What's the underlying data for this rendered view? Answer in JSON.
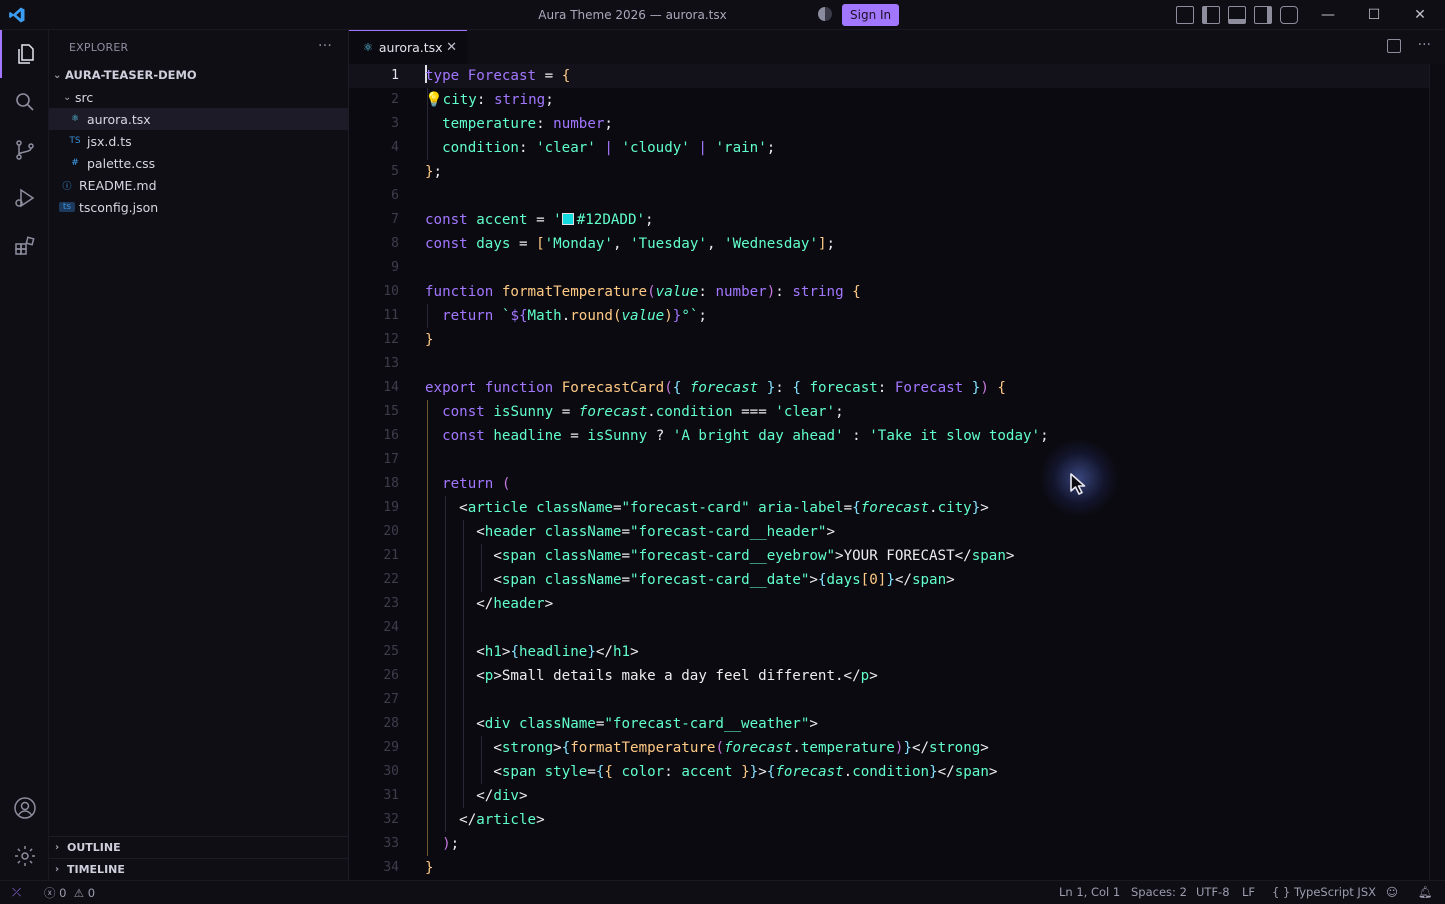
{
  "titlebar": {
    "title": "Aura Theme 2026 — aurora.tsx",
    "sign_in": "Sign In"
  },
  "sidebar": {
    "header": "EXPLORER",
    "more": "···",
    "root": "AURA-TEASER-DEMO",
    "folder": "src",
    "files": [
      {
        "name": "aurora.tsx",
        "icon": "⚛",
        "color": "#61dafb"
      },
      {
        "name": "jsx.d.ts",
        "icon": "TS",
        "color": "#3b8fd6"
      },
      {
        "name": "palette.css",
        "icon": "#",
        "color": "#42a5f5"
      }
    ],
    "root_files": [
      {
        "name": "README.md",
        "icon": "ⓘ",
        "color": "#42a5f5"
      },
      {
        "name": "tsconfig.json",
        "icon": "ts",
        "color": "#3b8fd6"
      }
    ],
    "panels": [
      "OUTLINE",
      "TIMELINE"
    ]
  },
  "tab": {
    "label": "aurora.tsx",
    "close": "✕"
  },
  "editor": {
    "current_line": 1,
    "swatch_color": "#12DADD"
  },
  "statusbar": {
    "errors": "0",
    "warnings": "0",
    "position": "Ln 1, Col 1",
    "spaces": "Spaces: 2",
    "encoding": "UTF-8",
    "eol": "LF",
    "braces": "{ }",
    "language": "TypeScript JSX"
  }
}
